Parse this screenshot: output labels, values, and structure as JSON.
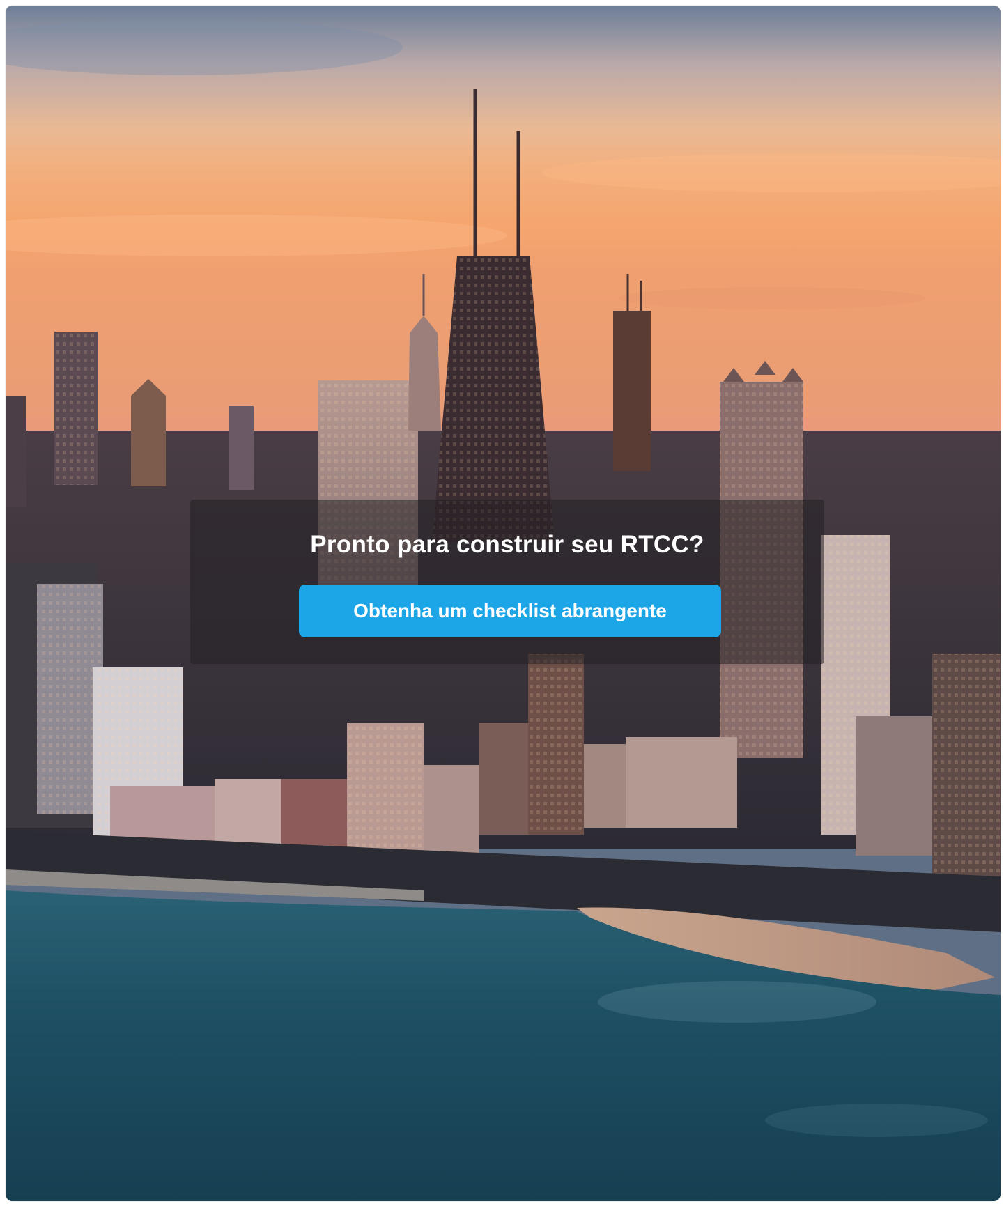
{
  "cta_section": {
    "headline": "Pronto para construir seu RTCC?",
    "button_label": "Obtenha um checklist abrangente"
  },
  "background": {
    "description_icon": "city-skyline-photo",
    "colors": {
      "sky_top": "#6f8199",
      "sky_glow": "#f3b27c",
      "horizon": "#f0a36a",
      "water": "#1f4f63",
      "button": "#1ca6e8"
    }
  }
}
